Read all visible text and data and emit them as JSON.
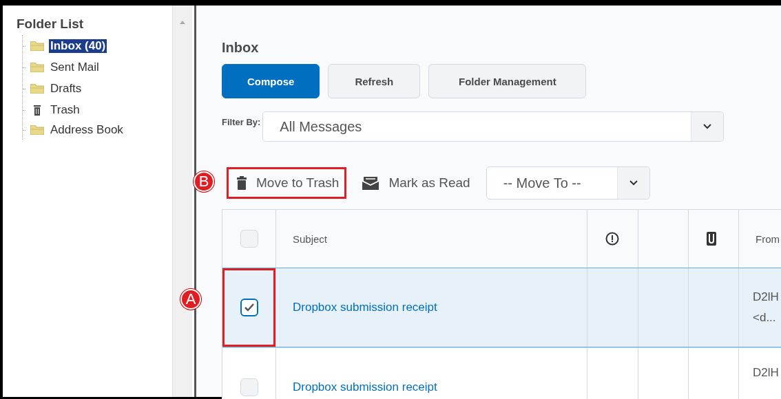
{
  "sidebar": {
    "title": "Folder List",
    "items": [
      {
        "label": "Inbox (40)",
        "kind": "folder",
        "selected": true
      },
      {
        "label": "Sent Mail",
        "kind": "folder",
        "selected": false
      },
      {
        "label": "Drafts",
        "kind": "folder",
        "selected": false
      },
      {
        "label": "Trash",
        "kind": "trash",
        "selected": false
      },
      {
        "label": "Address Book",
        "kind": "folder",
        "selected": false
      }
    ]
  },
  "main": {
    "title": "Inbox",
    "buttons": [
      {
        "label": "Compose",
        "primary": true
      },
      {
        "label": "Refresh",
        "primary": false
      },
      {
        "label": "Folder Management",
        "primary": false
      }
    ],
    "filter": {
      "label": "Filter By:",
      "value": "All Messages"
    },
    "toolbar": {
      "callout": "B",
      "actions": [
        {
          "label": "Move to Trash",
          "kind": "trash",
          "highlighted": true
        },
        {
          "label": "Mark as Read",
          "kind": "read",
          "highlighted": false
        }
      ],
      "move_to": {
        "value": "-- Move To --"
      }
    },
    "table": {
      "columns": [
        {
          "kind": "checkbox",
          "checked": false
        },
        {
          "kind": "text",
          "label": "Subject"
        },
        {
          "kind": "priority"
        },
        {
          "kind": "blank"
        },
        {
          "kind": "attachment"
        },
        {
          "kind": "text",
          "label": "From"
        }
      ],
      "rows": [
        {
          "selected": true,
          "checked": true,
          "highlighted": true,
          "callout": "A",
          "subject": "Dropbox submission receipt",
          "from": [
            "D2lH",
            "<d..."
          ]
        },
        {
          "selected": false,
          "checked": false,
          "highlighted": false,
          "subject": "Dropbox submission receipt",
          "from": [
            "D2lH"
          ]
        }
      ]
    }
  }
}
